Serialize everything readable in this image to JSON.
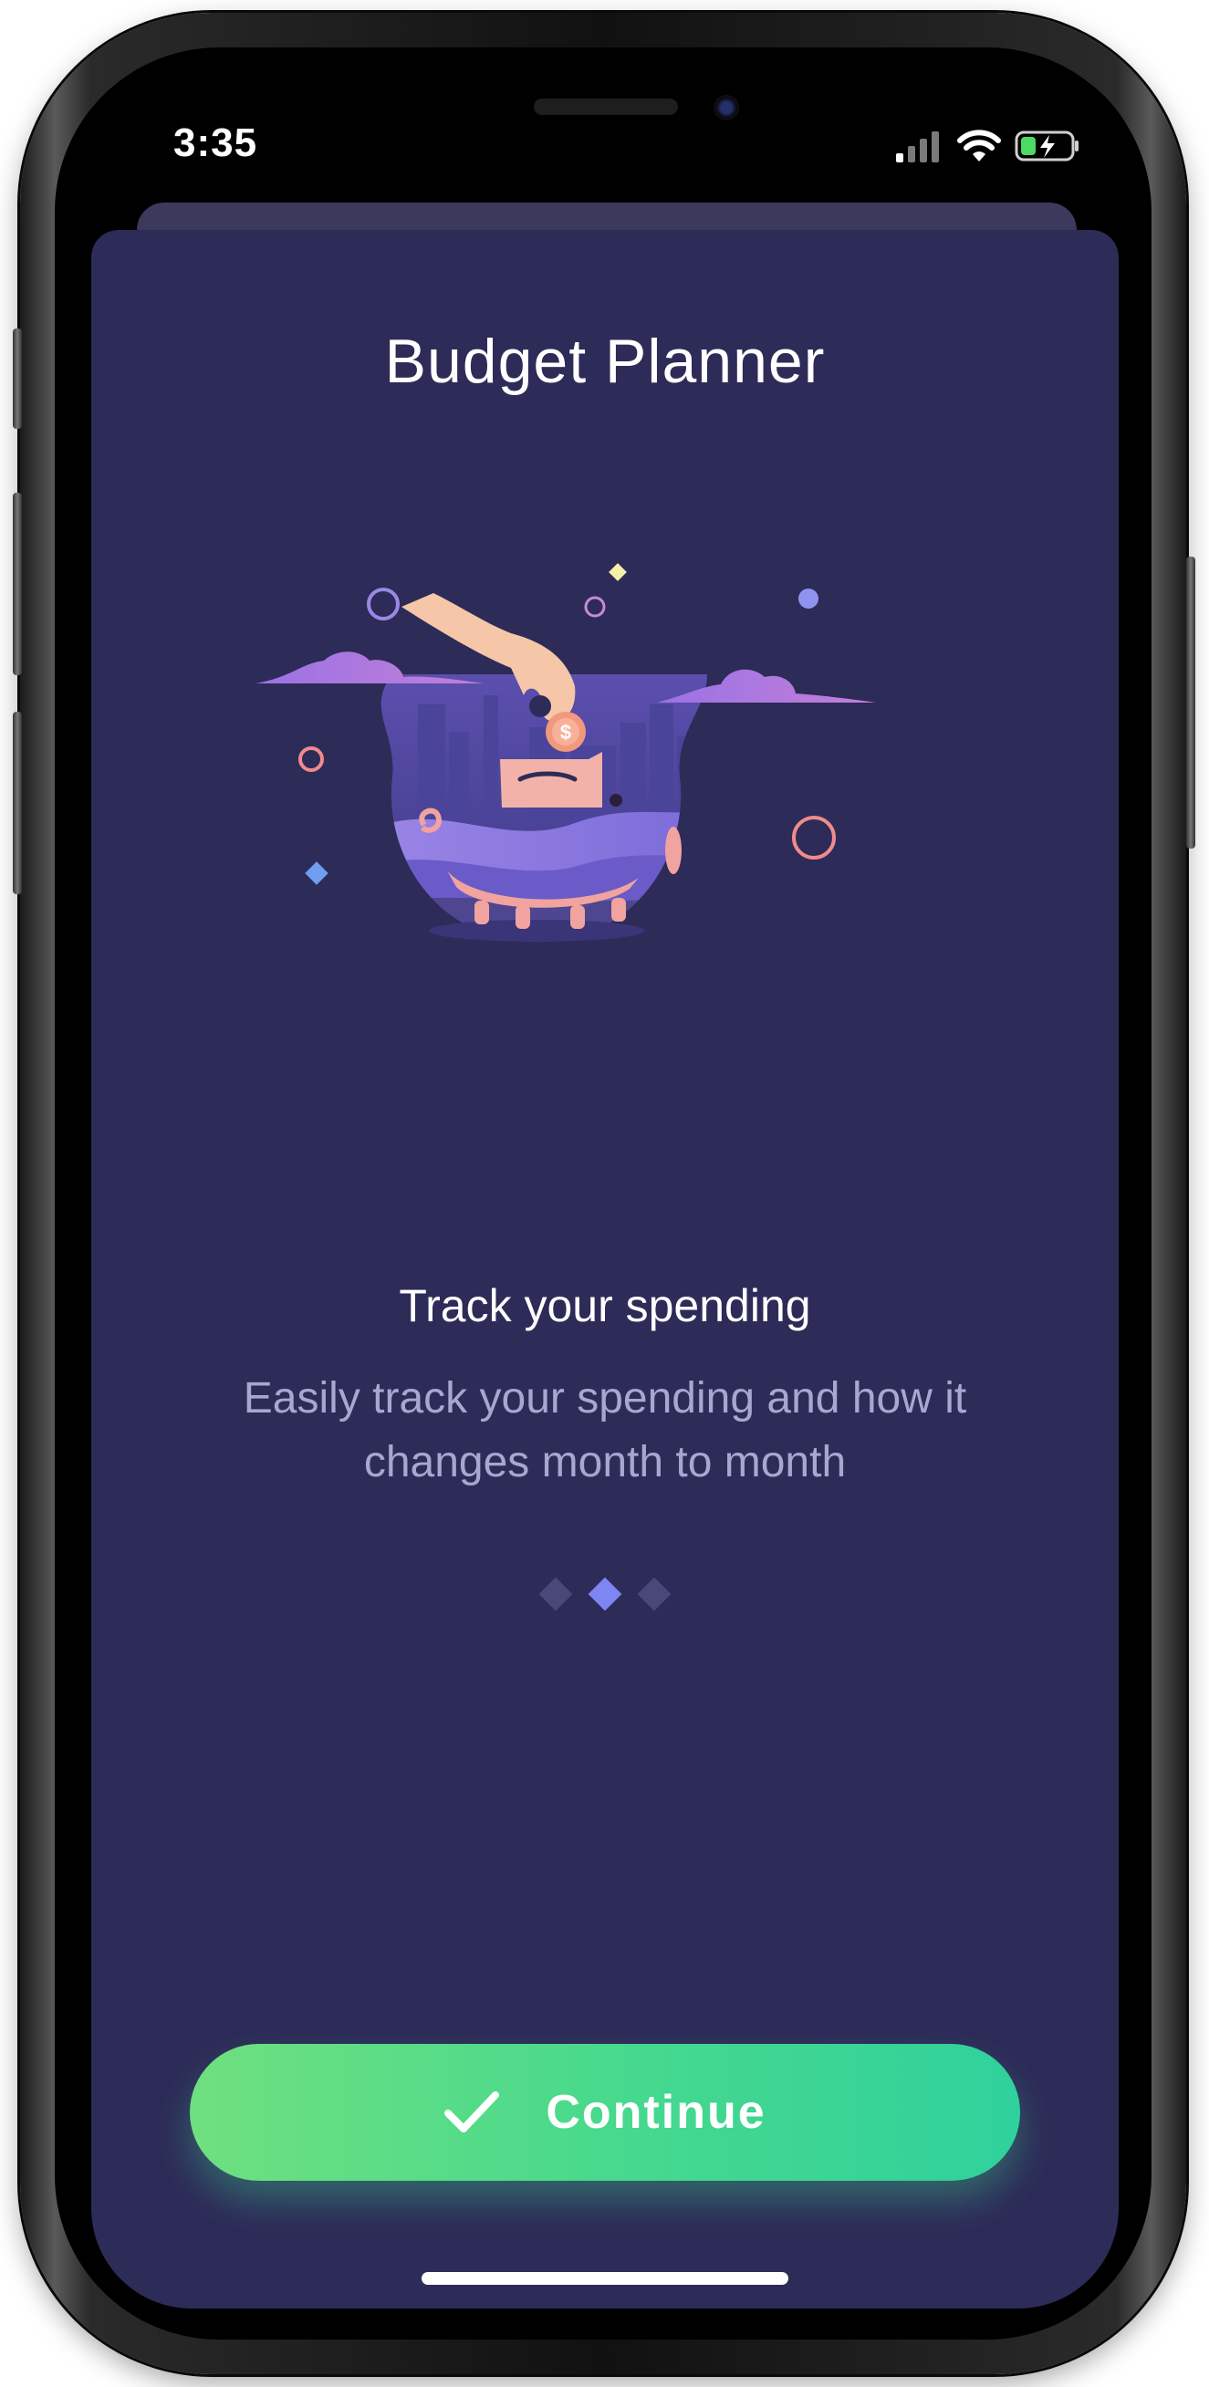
{
  "status_bar": {
    "time": "3:35",
    "icons": [
      "signal-icon",
      "wifi-icon",
      "battery-charging-icon"
    ]
  },
  "app": {
    "title": "Budget Planner"
  },
  "onboarding": {
    "illustration": "piggy-bank-coin-illustration",
    "slide_title": "Track your spending",
    "slide_description": "Easily track your spending and how it changes month to month",
    "pager": {
      "total": 3,
      "active_index": 1
    }
  },
  "actions": {
    "continue_label": "Continue",
    "continue_icon": "checkmark-icon"
  },
  "colors": {
    "background": "#2d2b58",
    "accent_start": "#6fe07f",
    "accent_end": "#2fd19c",
    "pager_active": "#7d86f2",
    "pager_inactive": "#4a4878",
    "description_text": "#a9a6cf"
  }
}
